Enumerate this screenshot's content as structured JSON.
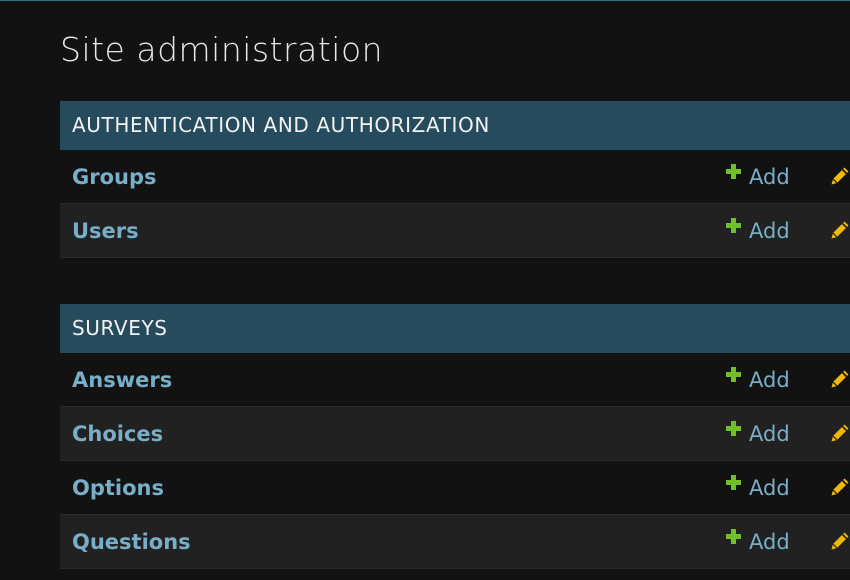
{
  "page": {
    "title": "Site administration"
  },
  "colors": {
    "background": "#121212",
    "header_bg": "#264b5d",
    "link": "#79aec8",
    "add_icon": "#70bf2b",
    "change_icon": "#efb80b"
  },
  "modules": [
    {
      "caption": "AUTHENTICATION AND AUTHORIZATION",
      "models": [
        {
          "name": "Groups",
          "add_label": "Add",
          "add_icon": "plus-icon",
          "change_icon": "pencil-icon"
        },
        {
          "name": "Users",
          "add_label": "Add",
          "add_icon": "plus-icon",
          "change_icon": "pencil-icon"
        }
      ]
    },
    {
      "caption": "SURVEYS",
      "models": [
        {
          "name": "Answers",
          "add_label": "Add",
          "add_icon": "plus-icon",
          "change_icon": "pencil-icon"
        },
        {
          "name": "Choices",
          "add_label": "Add",
          "add_icon": "plus-icon",
          "change_icon": "pencil-icon"
        },
        {
          "name": "Options",
          "add_label": "Add",
          "add_icon": "plus-icon",
          "change_icon": "pencil-icon"
        },
        {
          "name": "Questions",
          "add_label": "Add",
          "add_icon": "plus-icon",
          "change_icon": "pencil-icon"
        }
      ]
    }
  ]
}
